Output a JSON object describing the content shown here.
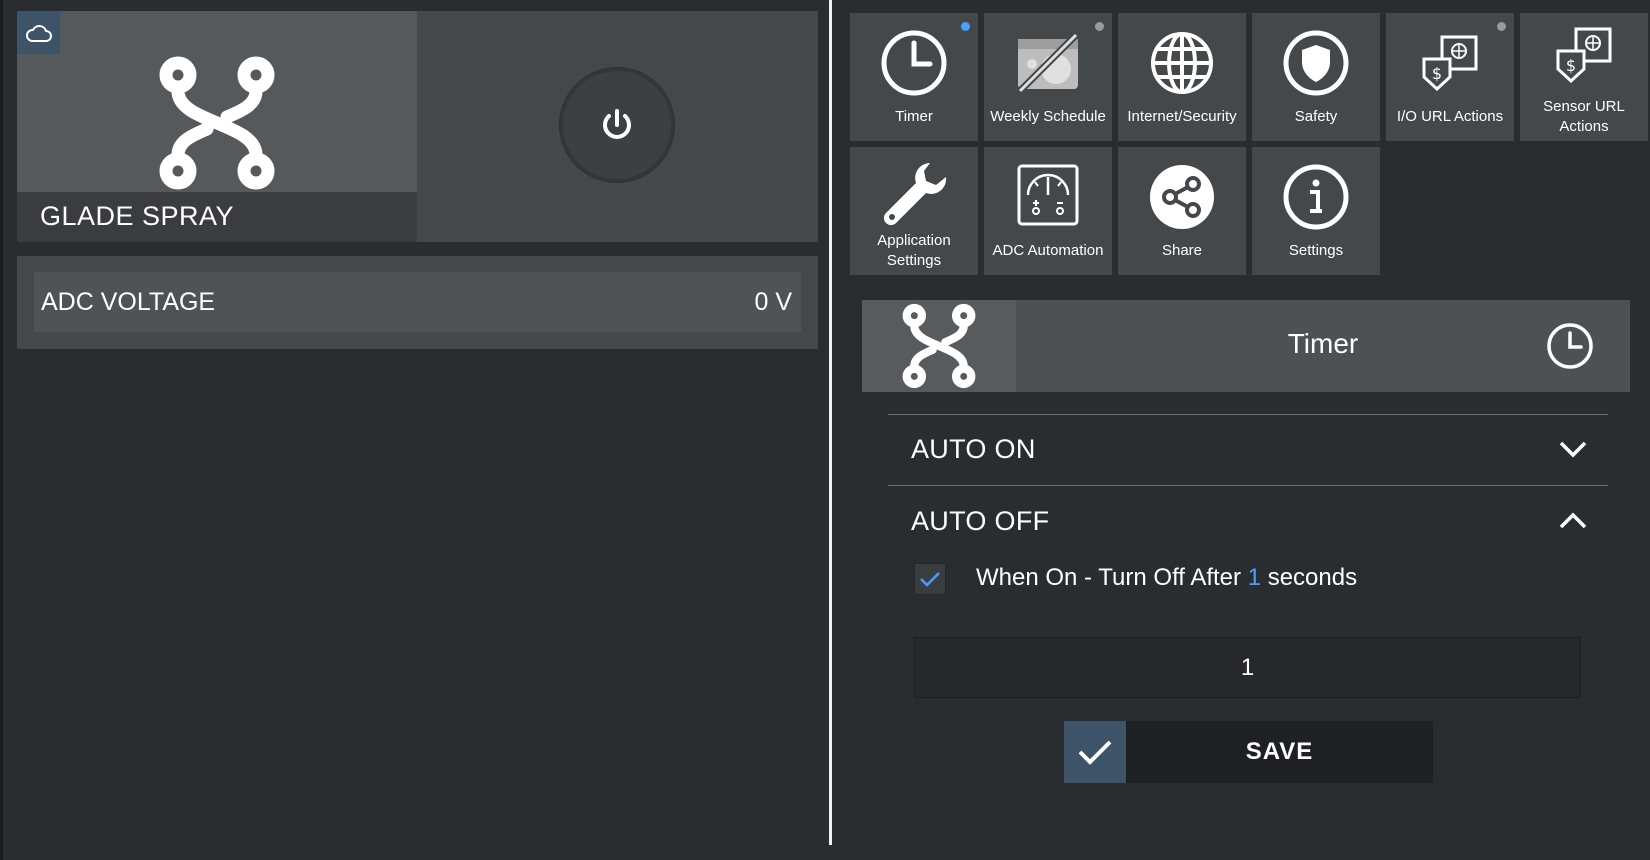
{
  "device": {
    "name": "GLADE SPRAY",
    "cloud_icon": "cloud-icon",
    "device_icon": "relay-switch-icon",
    "power_icon": "power-icon"
  },
  "adc": {
    "label": "ADC VOLTAGE",
    "value": "0 V"
  },
  "tiles": {
    "timer": {
      "label": "Timer",
      "icon": "clock-icon",
      "dot": "#4a9eff"
    },
    "weekly_schedule": {
      "label": "Weekly Schedule",
      "icon": "calendar-off-icon",
      "dot": "#9a9a9a"
    },
    "internet_security": {
      "label": "Internet/Security",
      "icon": "globe-icon"
    },
    "safety": {
      "label": "Safety",
      "icon": "shield-icon"
    },
    "io_url_actions": {
      "label": "I/O URL Actions",
      "icon": "url-actions-icon",
      "dot": "#9a9a9a"
    },
    "sensor_url_actions": {
      "label": "Sensor URL Actions",
      "icon": "sensor-url-icon"
    },
    "application_settings": {
      "label": "Application Settings",
      "icon": "wrench-icon"
    },
    "adc_automation": {
      "label": "ADC Automation",
      "icon": "gauge-icon"
    },
    "share": {
      "label": "Share",
      "icon": "share-icon"
    },
    "settings": {
      "label": "Settings",
      "icon": "info-icon"
    }
  },
  "timer_panel": {
    "title": "Timer",
    "auto_on": {
      "title": "AUTO ON",
      "expanded": false
    },
    "auto_off": {
      "title": "AUTO OFF",
      "expanded": true,
      "checked": true,
      "text_before": "When On - Turn Off After",
      "seconds_value": "1",
      "text_after": "seconds",
      "input_value": "1"
    },
    "save_label": "SAVE"
  },
  "colors": {
    "accent": "#4a9eff",
    "panel": "#45484b",
    "background": "#2a2d30",
    "save_check": "#3d5468"
  }
}
